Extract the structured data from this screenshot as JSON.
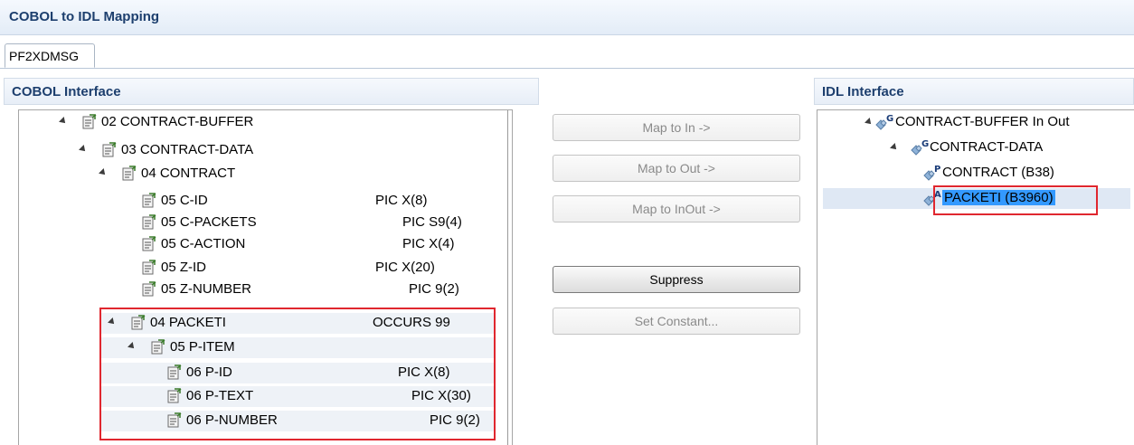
{
  "window": {
    "title": "COBOL to IDL Mapping"
  },
  "tabs": [
    {
      "label": "PF2XDMSG"
    }
  ],
  "cobol_panel": {
    "title": "COBOL Interface",
    "rows": [
      {
        "name": "02 CONTRACT-BUFFER",
        "pic": ""
      },
      {
        "name": "03 CONTRACT-DATA",
        "pic": ""
      },
      {
        "name": "04 CONTRACT",
        "pic": ""
      },
      {
        "name": "05 C-ID",
        "pic": "PIC X(8)"
      },
      {
        "name": "05 C-PACKETS",
        "pic": "PIC S9(4)"
      },
      {
        "name": "05 C-ACTION",
        "pic": "PIC X(4)"
      },
      {
        "name": "05 Z-ID",
        "pic": "PIC X(20)"
      },
      {
        "name": "05 Z-NUMBER",
        "pic": "PIC 9(2)"
      },
      {
        "name": "04 PACKETI",
        "pic": "OCCURS 99"
      },
      {
        "name": "05 P-ITEM",
        "pic": ""
      },
      {
        "name": "06 P-ID",
        "pic": "PIC X(8)"
      },
      {
        "name": "06 P-TEXT",
        "pic": "PIC X(30)"
      },
      {
        "name": "06 P-NUMBER",
        "pic": "PIC 9(2)"
      }
    ]
  },
  "buttons": {
    "map_in": "Map to In ->",
    "map_out": "Map to Out ->",
    "map_inout": "Map to InOut ->",
    "suppress": "Suppress",
    "set_constant": "Set Constant..."
  },
  "idl_panel": {
    "title": "IDL Interface",
    "rows": [
      {
        "label": "CONTRACT-BUFFER In Out",
        "badge": "G"
      },
      {
        "label": "CONTRACT-DATA",
        "badge": "G"
      },
      {
        "label": "CONTRACT  (B38)",
        "badge": "P"
      },
      {
        "label": "PACKETI  (B3960)",
        "badge": "A"
      }
    ]
  },
  "colors": {
    "highlight_border": "#e0272f",
    "selection": "#3399ff",
    "header_text": "#1d3f6e"
  }
}
